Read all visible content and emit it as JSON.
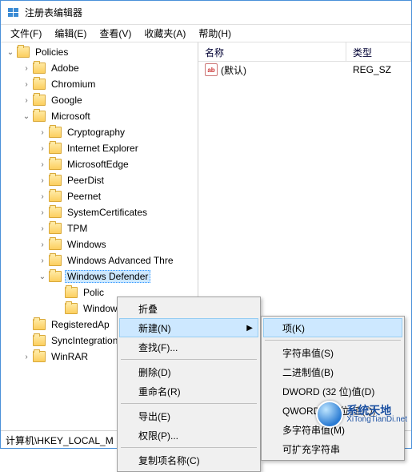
{
  "window": {
    "title": "注册表编辑器"
  },
  "menu": {
    "file": "文件(F)",
    "edit": "编辑(E)",
    "view": "查看(V)",
    "favorites": "收藏夹(A)",
    "help": "帮助(H)"
  },
  "tree": {
    "policies": "Policies",
    "adobe": "Adobe",
    "chromium": "Chromium",
    "google": "Google",
    "microsoft": "Microsoft",
    "cryptography": "Cryptography",
    "internet_explorer": "Internet Explorer",
    "microsoft_edge": "MicrosoftEdge",
    "peerdist": "PeerDist",
    "peernet": "Peernet",
    "system_certificates": "SystemCertificates",
    "tpm": "TPM",
    "windows": "Windows",
    "windows_advanced_threat": "Windows Advanced Thre",
    "windows_defender": "Windows Defender",
    "polic": "Polic",
    "window_child": "Window",
    "registered_ap": "RegisteredAp",
    "sync_integration": "SyncIntegration",
    "winrar": "WinRAR"
  },
  "list": {
    "col_name": "名称",
    "col_type": "类型",
    "default_name": "(默认)",
    "default_type": "REG_SZ"
  },
  "ctx1": {
    "collapse": "折叠",
    "new": "新建(N)",
    "find": "查找(F)...",
    "delete": "删除(D)",
    "rename": "重命名(R)",
    "export": "导出(E)",
    "permissions": "权限(P)...",
    "copy_key_name": "复制项名称(C)"
  },
  "ctx2": {
    "key": "项(K)",
    "string": "字符串值(S)",
    "binary": "二进制值(B)",
    "dword": "DWORD (32 位)值(D)",
    "qword": "QWORD (64 位)值(Q)",
    "multi_string": "多字符串值(M)",
    "expand_string": "可扩充字符串"
  },
  "status": {
    "path": "计算机\\HKEY_LOCAL_M"
  },
  "watermark": {
    "line1": "系统天地",
    "line2": "XiTongTianDi.net"
  }
}
